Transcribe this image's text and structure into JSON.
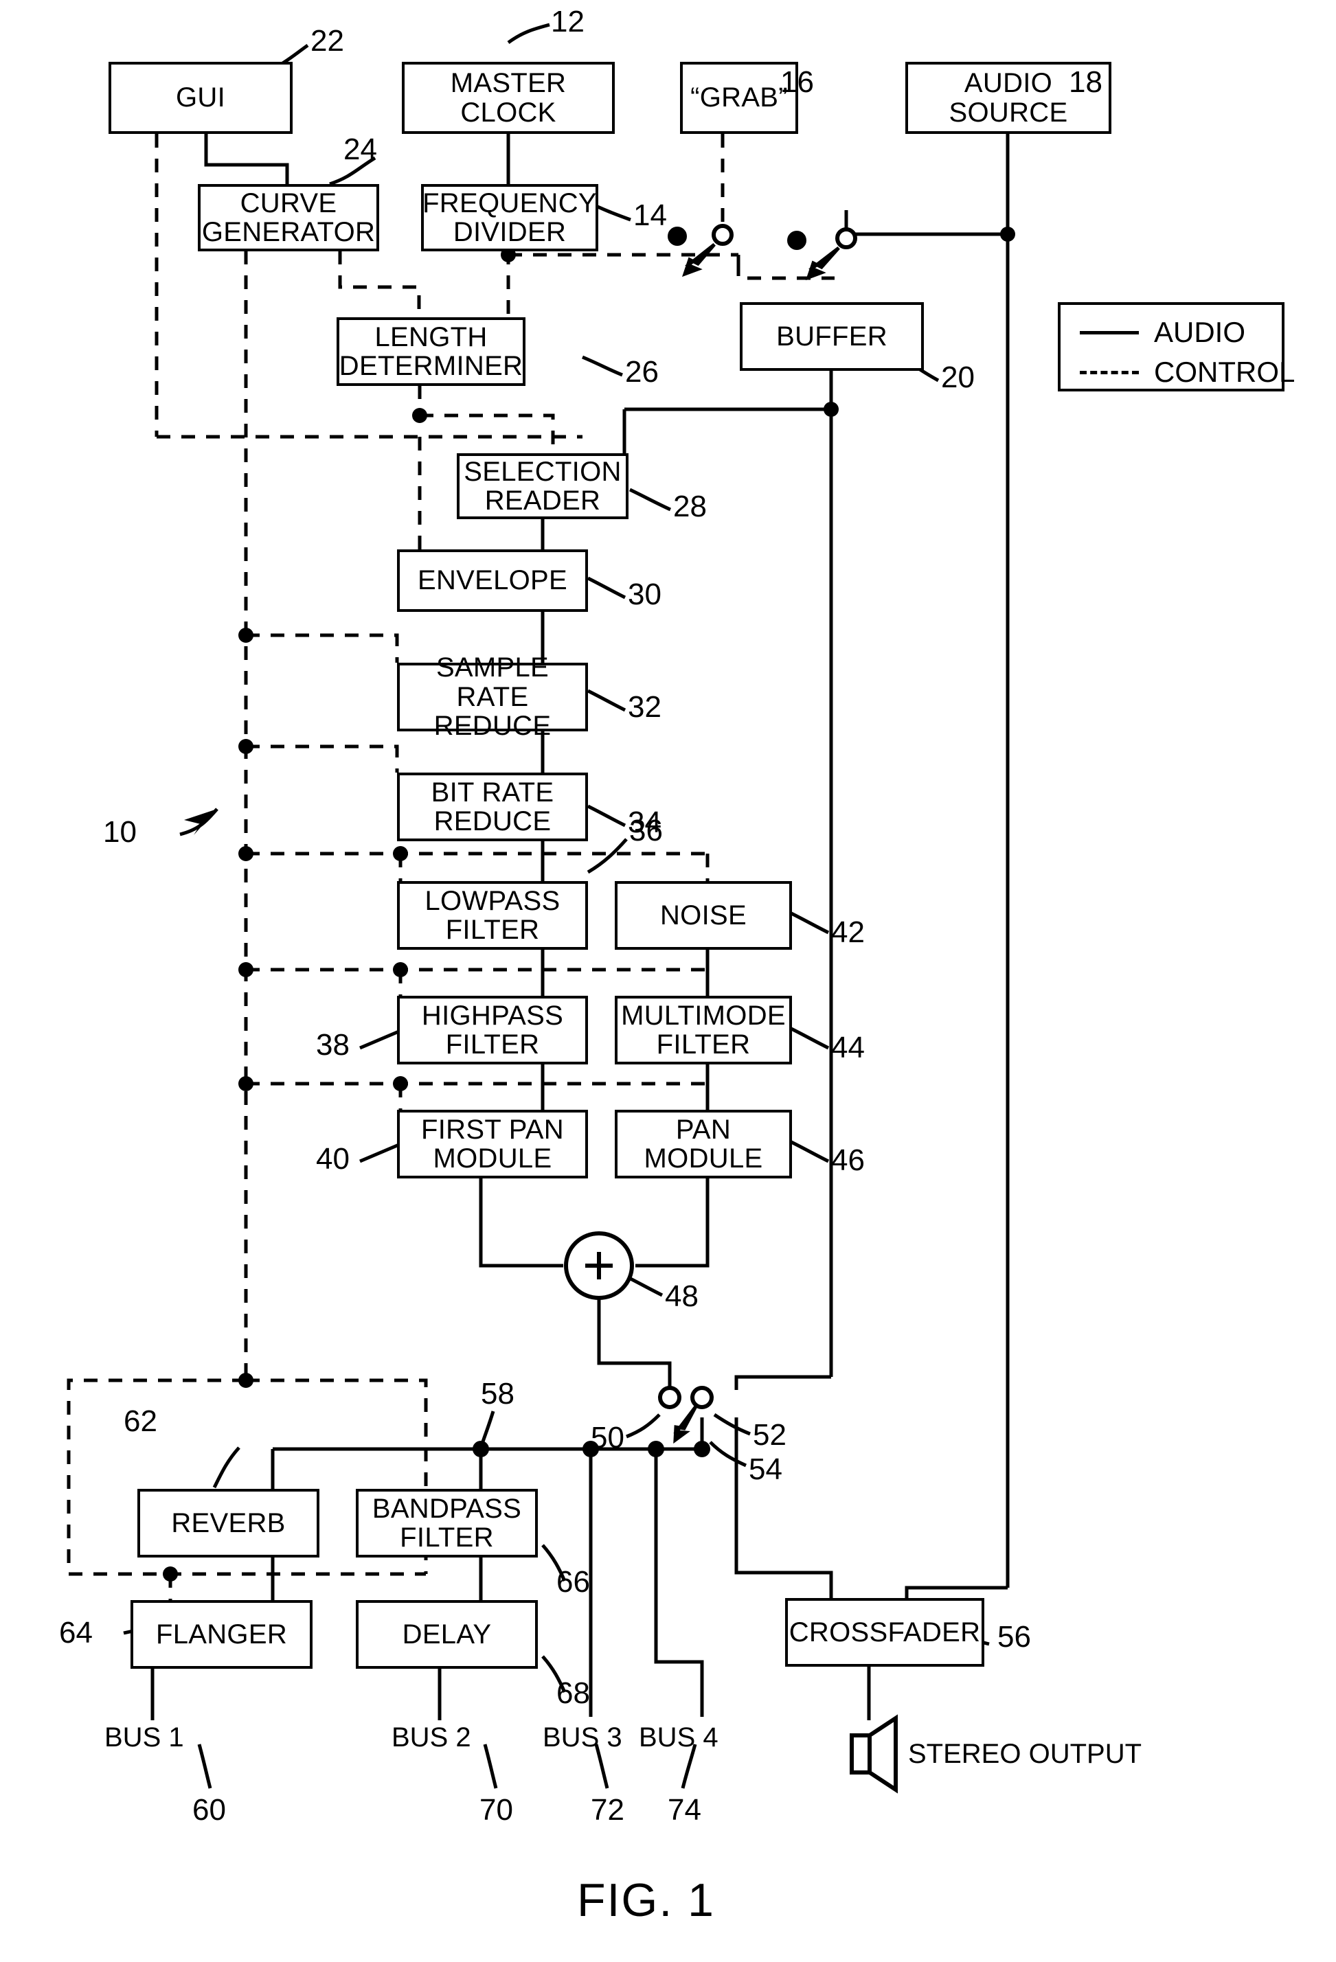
{
  "figure": {
    "caption": "FIG. 1",
    "system_ref": "10"
  },
  "legend": {
    "entries": [
      {
        "style": "solid",
        "label": "AUDIO"
      },
      {
        "style": "dashed",
        "label": "CONTROL"
      }
    ]
  },
  "blocks": [
    {
      "id": "gui",
      "label": "GUI",
      "ref": "22"
    },
    {
      "id": "master",
      "label": "MASTER CLOCK",
      "ref": "12"
    },
    {
      "id": "grab",
      "label": "“GRAB”",
      "ref": "16"
    },
    {
      "id": "audiosrc",
      "label": "AUDIO SOURCE",
      "ref": "18"
    },
    {
      "id": "curve",
      "label": "CURVE\nGENERATOR",
      "ref": "24"
    },
    {
      "id": "freqdiv",
      "label": "FREQUENCY\nDIVIDER",
      "ref": "14"
    },
    {
      "id": "buffer",
      "label": "BUFFER",
      "ref": "20"
    },
    {
      "id": "lengthdet",
      "label": "LENGTH\nDETERMINER",
      "ref": "26"
    },
    {
      "id": "selread",
      "label": "SELECTION\nREADER",
      "ref": "28"
    },
    {
      "id": "envelope",
      "label": "ENVELOPE",
      "ref": "30"
    },
    {
      "id": "samplerate",
      "label": "SAMPLE RATE\nREDUCE",
      "ref": "32"
    },
    {
      "id": "bitrate",
      "label": "BIT RATE\nREDUCE",
      "ref": "34"
    },
    {
      "id": "lowpass",
      "label": "LOWPASS\nFILTER",
      "ref": "36"
    },
    {
      "id": "noise",
      "label": "NOISE",
      "ref": "42"
    },
    {
      "id": "highpass",
      "label": "HIGHPASS\nFILTER",
      "ref": "38"
    },
    {
      "id": "multimode",
      "label": "MULTIMODE\nFILTER",
      "ref": "44"
    },
    {
      "id": "firstpan",
      "label": "FIRST PAN\nMODULE",
      "ref": "40"
    },
    {
      "id": "pan",
      "label": "PAN\nMODULE",
      "ref": "46"
    },
    {
      "id": "reverb",
      "label": "REVERB",
      "ref": "62"
    },
    {
      "id": "bandpass",
      "label": "BANDPASS\nFILTER",
      "ref": "66"
    },
    {
      "id": "flanger",
      "label": "FLANGER",
      "ref": "64"
    },
    {
      "id": "delay",
      "label": "DELAY",
      "ref": "68"
    },
    {
      "id": "crossfader",
      "label": "CROSSFADER",
      "ref": "56"
    }
  ],
  "nodes": {
    "summer": {
      "symbol": "+",
      "ref": "48"
    },
    "switch_a": {
      "ref": "50"
    },
    "switch_b": {
      "ref": "52"
    },
    "switch_pole": {
      "ref": "54"
    },
    "send_bus": {
      "ref": "58"
    }
  },
  "buses": [
    {
      "label": "BUS 1",
      "ref": "60"
    },
    {
      "label": "BUS 2",
      "ref": "70"
    },
    {
      "label": "BUS 3",
      "ref": "72"
    },
    {
      "label": "BUS 4",
      "ref": "74"
    }
  ],
  "output": {
    "label": "STEREO OUTPUT",
    "icon": "speaker-icon"
  },
  "colors": {
    "line": "#000000",
    "background": "#ffffff"
  }
}
